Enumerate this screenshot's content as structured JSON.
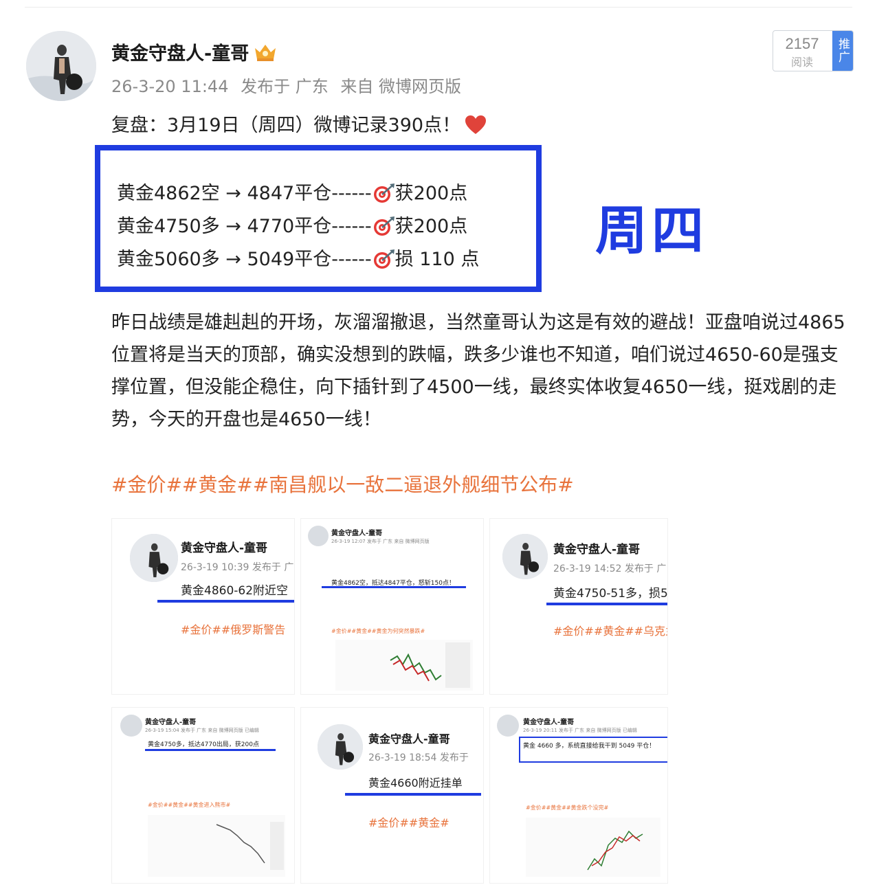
{
  "post": {
    "username": "黄金守盘人-童哥",
    "crown_icon": "vip-crown-icon",
    "meta": {
      "time": "26-3-20 11:44",
      "published": "发布于 广东",
      "source": "来自 微博网页版"
    },
    "read_count": "2157",
    "read_label": "阅读",
    "promote_label": "推广",
    "review_line": "复盘：3月19日（周四）微博记录390点！",
    "trades": [
      {
        "entry": "黄金4862空 → 4847平仓------",
        "result": "获200点"
      },
      {
        "entry": "黄金4750多 → 4770平仓------",
        "result": "获200点"
      },
      {
        "entry": "黄金5060多 → 5049平仓------",
        "result": "损 110 点"
      }
    ],
    "weekday_overlay": "周四",
    "paragraph": "昨日战绩是雄赳赳的开场，灰溜溜撤退，当然童哥认为这是有效的避战！亚盘咱说过4865位置将是当天的顶部，确实没想到的跌幅，跌多少谁也不知道，咱们说过4650-60是强支撑位置，但没能企稳住，向下插针到了4500一线，最终实体收复4650一线，挺戏剧的走势，今天的开盘也是4650一线！",
    "hashtags": "#金价##黄金##南昌舰以一敌二逼退外舰细节公布#"
  },
  "thumbnails": [
    {
      "name": "黄金守盘人-童哥",
      "meta": "26-3-19 10:39 发布于 广",
      "text": "黄金4860-62附近空",
      "tags": "#金价##俄罗斯警告"
    },
    {
      "name": "黄金守盘人-童哥",
      "meta": "26-3-19 12:07 发布于 广东 来自 微博网页版",
      "text": "黄金4862空，抵达4847平仓，怒斩150点！",
      "tags": "#金价##黄金##黄金为何突然暴跌#"
    },
    {
      "name": "黄金守盘人-童哥",
      "meta": "26-3-19 14:52 发布于 广",
      "text": "黄金4750-51多，损5",
      "tags": "#金价##黄金##乌克兰"
    },
    {
      "name": "黄金守盘人-童哥",
      "meta": "26-3-19 15:04 发布于 广东 来自 微博网页版 已编辑",
      "text": "黄金4750多，抵达4770出局，获200点",
      "tags": "#金价##黄金##黄金进入熊市#"
    },
    {
      "name": "黄金守盘人-童哥",
      "meta": "26-3-19 18:54 发布于",
      "text": "黄金4660附近挂单",
      "tags": "#金价##黄金#"
    },
    {
      "name": "黄金守盘人-童哥",
      "meta": "26-3-19 20:11 发布于 广东 来自 微博网页版 已编辑",
      "text": "黄金 4660 多，系统直接给我干到 5049 平仓！",
      "tags": "#金价##黄金##黄金跌个没完#"
    }
  ],
  "colors": {
    "accent_blue": "#1f3ce0",
    "tag_orange": "#e8733c",
    "meta_gray": "#8a8a8a"
  }
}
